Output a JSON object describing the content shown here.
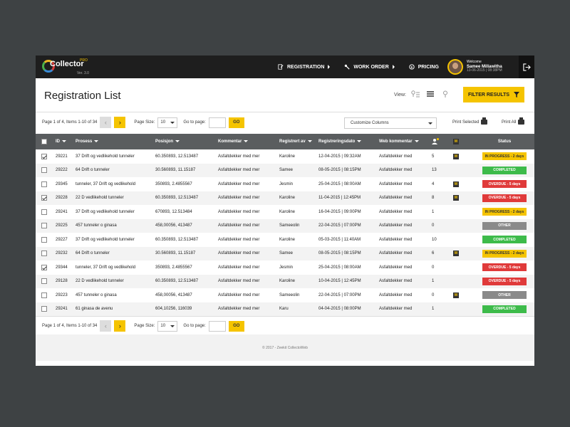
{
  "app": {
    "logo_text": "Collector",
    "logo_badge": "PRO",
    "version": "Ver. 3.0"
  },
  "nav": {
    "registration": "REGISTRATION",
    "work_order": "WORK ORDER",
    "pricing": "PRICING"
  },
  "user": {
    "welcome": "Welcome",
    "name": "Samee Millawitha",
    "timestamp": "13-06-2015 | 08:38PM"
  },
  "header": {
    "title": "Registration List",
    "view_label": "View:",
    "filter_button": "FILTER RESULTS"
  },
  "pager": {
    "summary": "Page 1 of 4, Items 1-10 of 34",
    "page_size_label": "Page Size:",
    "page_size_value": "10",
    "goto_label": "Go to page:",
    "go_button": "GO"
  },
  "toolbar": {
    "customize_columns": "Customize Columns",
    "print_selected": "Print Selected",
    "print_all": "Print All"
  },
  "table": {
    "headers": {
      "id": "ID",
      "prosess": "Prosess",
      "posisjon": "Posisjon",
      "kommentar": "Kommentar",
      "registrert_av": "Registrert av",
      "registreringsdato": "Registreringsdato",
      "web_kommentar": "Web kommentar",
      "status": "Status"
    },
    "rows": [
      {
        "checked": true,
        "id": "29221",
        "prosess": "37 Drift og vedlikehold tunneler",
        "posisjon": "60.350893, 12.513487",
        "kommentar": "Asfaltdekker med mer",
        "registrert_av": "Karoline",
        "dato": "12-04-2015 | 09:32AM",
        "web_kommentar": "Asfaltdekker med",
        "count": "5",
        "m": true,
        "status": "IN PROGRESS - 2 days",
        "status_type": "progress"
      },
      {
        "checked": false,
        "id": "29222",
        "prosess": "64 Drift o tunneler",
        "posisjon": "30.560893, 11.15187",
        "kommentar": "Asfaltdekker med mer",
        "registrert_av": "Samee",
        "dato": "08-05-2015 | 08:15PM",
        "web_kommentar": "Asfaltdekker med",
        "count": "13",
        "m": false,
        "status": "COMPLETED",
        "status_type": "completed"
      },
      {
        "checked": false,
        "id": "29345",
        "prosess": "tunneler, 37 Drift og vedlikehold",
        "posisjon": "350893, 2.4855567",
        "kommentar": "Asfaltdekker med mer",
        "registrert_av": "Jesmin",
        "dato": "25-04-2015 | 08:00AM",
        "web_kommentar": "Asfaltdekker med",
        "count": "4",
        "m": true,
        "status": "OVERDUE - 5 days",
        "status_type": "overdue"
      },
      {
        "checked": true,
        "id": "29228",
        "prosess": "22 D vedlikehold tunneler",
        "posisjon": "60.350893, 12.513487",
        "kommentar": "Asfaltdekker med mer",
        "registrert_av": "Karoline",
        "dato": "11-04-2015 | 12:45PM",
        "web_kommentar": "Asfaltdekker med",
        "count": "8",
        "m": true,
        "status": "OVERDUE - 5 days",
        "status_type": "overdue"
      },
      {
        "checked": false,
        "id": "29241",
        "prosess": "37 Drift og vedlikehold tunneler",
        "posisjon": "670893, 12.513484",
        "kommentar": "Asfaltdekker med mer",
        "registrert_av": "Karoline",
        "dato": "16-04-2015 | 09:00PM",
        "web_kommentar": "Asfaltdekker med",
        "count": "1",
        "m": false,
        "status": "IN PROGRESS - 2 days",
        "status_type": "progress"
      },
      {
        "checked": false,
        "id": "29225",
        "prosess": "457 tunneler o ginasa",
        "posisjon": "458,00056, 413487",
        "kommentar": "Asfaltdekker med mer",
        "registrert_av": "Sameeolin",
        "dato": "22-04-2015 | 07:00PM",
        "web_kommentar": "Asfaltdekker med",
        "count": "0",
        "m": false,
        "status": "OTHER",
        "status_type": "other"
      },
      {
        "checked": false,
        "id": "29227",
        "prosess": "37 Drift og vedlikehold tunneler",
        "posisjon": "60.350893, 12.513487",
        "kommentar": "Asfaltdekker med mer",
        "registrert_av": "Karoline",
        "dato": "05-03-2015 | 11:40AM",
        "web_kommentar": "Asfaltdekker med",
        "count": "10",
        "m": false,
        "status": "COMPLETED",
        "status_type": "completed"
      },
      {
        "checked": false,
        "id": "29232",
        "prosess": "64 Drift o tunneler",
        "posisjon": "30.560893, 11.15187",
        "kommentar": "Asfaltdekker med mer",
        "registrert_av": "Samee",
        "dato": "08-05-2015 | 08:15PM",
        "web_kommentar": "Asfaltdekker med",
        "count": "6",
        "m": true,
        "status": "IN PROGRESS - 2 days",
        "status_type": "progress"
      },
      {
        "checked": true,
        "id": "29344",
        "prosess": "tunneler, 37 Drift og vedlikehold",
        "posisjon": "350893, 2.4855567",
        "kommentar": "Asfaltdekker med mer",
        "registrert_av": "Jesmin",
        "dato": "25-04-2015 | 08:00AM",
        "web_kommentar": "Asfaltdekker med",
        "count": "0",
        "m": false,
        "status": "OVERDUE - 5 days",
        "status_type": "overdue"
      },
      {
        "checked": false,
        "id": "29128",
        "prosess": "22 D vedlikehold tunneler",
        "posisjon": "60.350893, 12.513487",
        "kommentar": "Asfaltdekker med mer",
        "registrert_av": "Karoline",
        "dato": "10-04-2015 | 12:45PM",
        "web_kommentar": "Asfaltdekker med",
        "count": "1",
        "m": false,
        "status": "OVERDUE - 5 days",
        "status_type": "overdue"
      },
      {
        "checked": false,
        "id": "29223",
        "prosess": "457 tunneler o ginasa",
        "posisjon": "458,00056, 413487",
        "kommentar": "Asfaltdekker med mer",
        "registrert_av": "Sameeolin",
        "dato": "22-04-2015 | 07:00PM",
        "web_kommentar": "Asfaltdekker med",
        "count": "0",
        "m": true,
        "status": "OTHER",
        "status_type": "other"
      },
      {
        "checked": false,
        "id": "29241",
        "prosess": "61 ginasa de avenu",
        "posisjon": "604,10256, 116039",
        "kommentar": "Asfaltdekker med mer",
        "registrert_av": "Karu",
        "dato": "04-04-2015 | 08:00PM",
        "web_kommentar": "Asfaltdekker med",
        "count": "1",
        "m": false,
        "status": "COMPLETED",
        "status_type": "completed"
      }
    ]
  },
  "footer": {
    "copyright": "© 2017 - Zeekit CollectoWeb"
  },
  "colors": {
    "accent": "#f5c400",
    "topbar": "#1e1e1e",
    "header_row": "#5a5d5f",
    "completed": "#3dbb4a",
    "overdue": "#e03a3a",
    "other": "#8a8a8a"
  }
}
